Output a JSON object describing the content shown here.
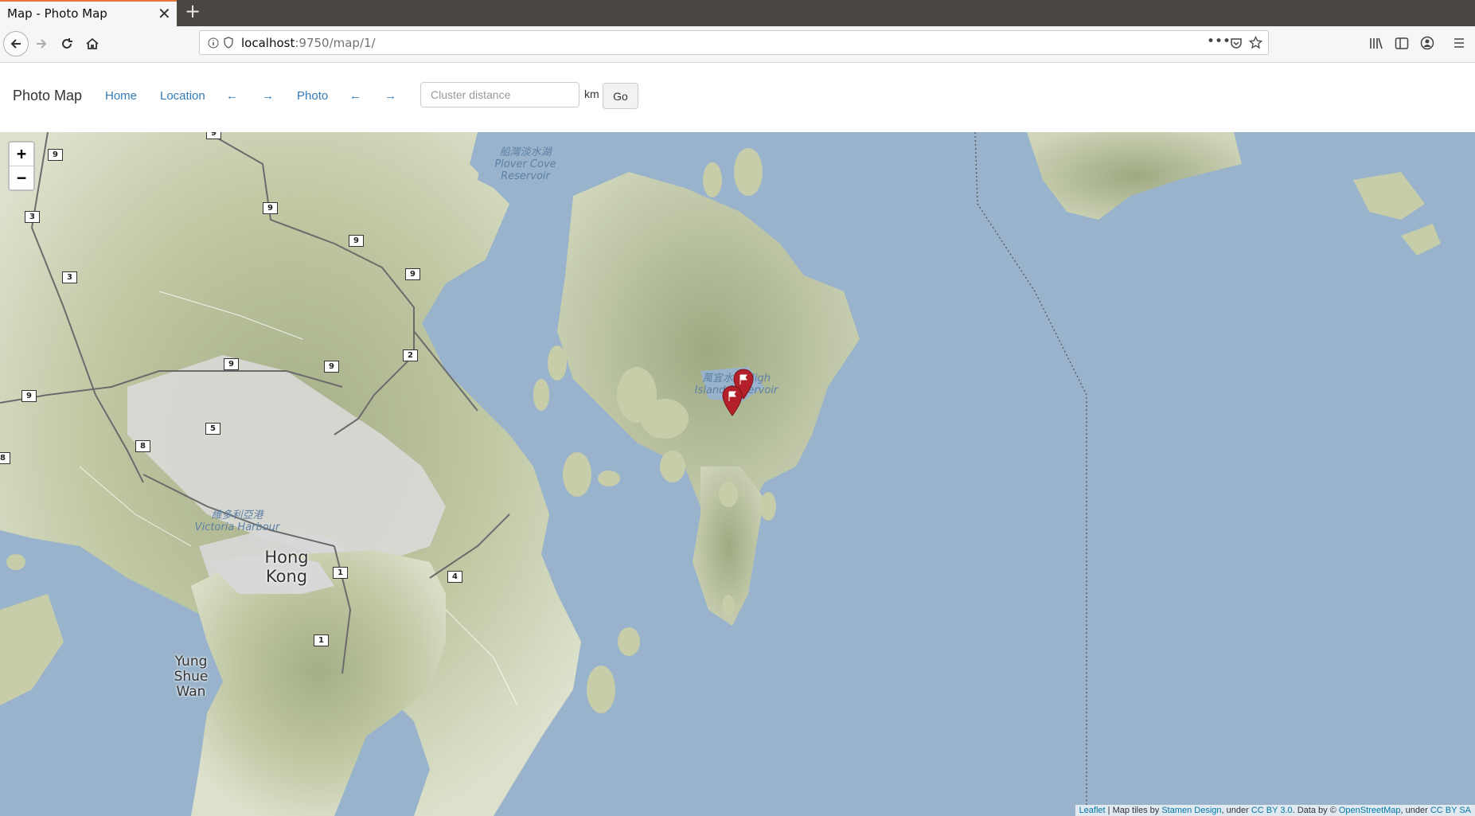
{
  "browser": {
    "tab_title": "Map - Photo Map",
    "url_host": "localhost",
    "url_rest": ":9750/map/1/"
  },
  "app": {
    "brand": "Photo Map",
    "nav": {
      "home": "Home",
      "location": "Location",
      "location_prev": "←",
      "location_next": "→",
      "photo": "Photo",
      "photo_prev": "←",
      "photo_next": "→"
    },
    "cluster": {
      "placeholder": "Cluster distance",
      "unit": "km",
      "go_label": "Go"
    }
  },
  "map": {
    "zoom_in": "+",
    "zoom_out": "−",
    "labels": {
      "plover_cn": "船灣淡水湖",
      "plover_en1": "Plover Cove",
      "plover_en2": "Reservoir",
      "high_island_cn": "萬宜水庫",
      "high_island_en1": "High",
      "high_island_en2": "Island Reservoir",
      "victoria_cn": "維多利亞港",
      "victoria_en": "Victoria Harbour",
      "hong": "Hong",
      "kong": "Kong",
      "yung": "Yung",
      "shue": "Shue",
      "wan": "Wan"
    },
    "route_shields": [
      "9",
      "9",
      "3",
      "9",
      "9",
      "3",
      "9",
      "2",
      "9",
      "9",
      "9",
      "5",
      "8",
      "8",
      "1",
      "4",
      "1"
    ],
    "markers": [
      {
        "name": "photo-marker-1",
        "icon": "flag-icon",
        "color": "#b3202a"
      },
      {
        "name": "photo-marker-2",
        "icon": "flag-icon",
        "color": "#b3202a"
      }
    ],
    "attribution": {
      "leaflet": "Leaflet",
      "sep1": " | Map tiles by ",
      "stamen": "Stamen Design",
      "sep2": ", under ",
      "ccby": "CC BY 3.0",
      "sep3": ". Data by © ",
      "osm": "OpenStreetMap",
      "sep4": ", under ",
      "ccbysa": "CC BY SA"
    }
  }
}
